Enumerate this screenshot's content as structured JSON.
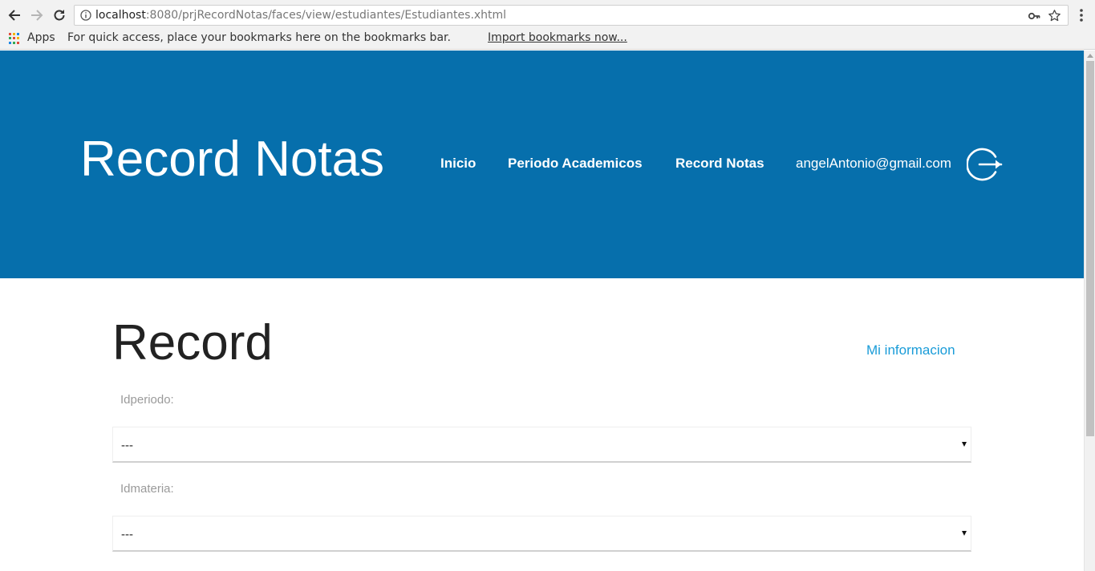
{
  "browser": {
    "url_host": "localhost",
    "url_rest": ":8080/prjRecordNotas/faces/view/estudiantes/Estudiantes.xhtml",
    "bookmarks": {
      "apps_label": "Apps",
      "hint": "For quick access, place your bookmarks here on the bookmarks bar.",
      "import_link": "Import bookmarks now..."
    }
  },
  "header": {
    "site_title": "Record Notas",
    "nav": {
      "inicio": "Inicio",
      "periodo": "Periodo Academicos",
      "record": "Record Notas"
    },
    "user_email": "angelAntonio@gmail.com"
  },
  "content": {
    "heading": "Record",
    "mi_informacion": "Mi informacion",
    "fields": {
      "periodo_label": "Idperiodo:",
      "periodo_value": "---",
      "materia_label": "Idmateria:",
      "materia_value": "---"
    }
  },
  "colors": {
    "header_bg": "#066fac",
    "link": "#1a9cd8"
  },
  "icons": [
    "back-icon",
    "forward-icon",
    "reload-icon",
    "info-icon",
    "key-icon",
    "star-icon",
    "menu-icon",
    "apps-grid-icon",
    "logout-icon",
    "dropdown-caret-icon"
  ]
}
